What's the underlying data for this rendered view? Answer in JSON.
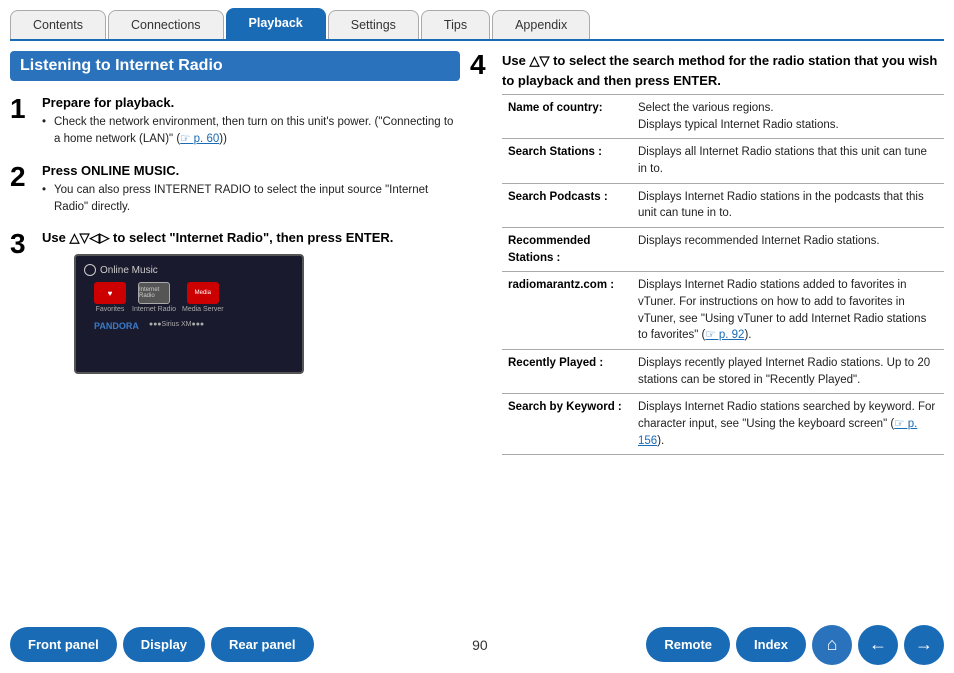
{
  "tabs": [
    {
      "label": "Contents",
      "active": false
    },
    {
      "label": "Connections",
      "active": false
    },
    {
      "label": "Playback",
      "active": true
    },
    {
      "label": "Settings",
      "active": false
    },
    {
      "label": "Tips",
      "active": false
    },
    {
      "label": "Appendix",
      "active": false
    }
  ],
  "section_title": "Listening to Internet Radio",
  "steps": [
    {
      "number": "1",
      "heading": "Prepare for playback.",
      "bullets": [
        "Check the network environment, then turn on this unit's power. (\"Connecting to a home network (LAN)\" (☞ p. 60))"
      ]
    },
    {
      "number": "2",
      "heading": "Press ONLINE MUSIC.",
      "bullets": [
        "You can also press INTERNET RADIO to select the input source \"Internet Radio\" directly."
      ]
    },
    {
      "number": "3",
      "heading": "Use △▽◁▷ to select \"Internet Radio\", then press ENTER.",
      "bullets": []
    }
  ],
  "step4": {
    "number": "4",
    "heading": "Use △▽ to select the search method for the radio station that you wish to playback and then press ENTER."
  },
  "table": [
    {
      "label": "Name of country:",
      "description": "Select the various regions.\nDisplays typical Internet Radio stations."
    },
    {
      "label": "Search Stations :",
      "description": "Displays all Internet Radio stations that this unit can tune in to."
    },
    {
      "label": "Search Podcasts :",
      "description": "Displays Internet Radio stations in the podcasts that this unit can tune in to."
    },
    {
      "label": "Recommended\nStations :",
      "description": "Displays recommended Internet Radio stations."
    },
    {
      "label": "radiomarantz.com :",
      "description": "Displays Internet Radio stations added to favorites in vTuner. For instructions on how to add to favorites in vTuner, see \"Using vTuner to add Internet Radio stations to favorites\" (☞ p. 92)."
    },
    {
      "label": "Recently Played :",
      "description": "Displays recently played Internet Radio stations. Up to 20 stations can be stored in \"Recently Played\"."
    },
    {
      "label": "Search by Keyword :",
      "description": "Displays Internet Radio stations searched by keyword. For character input, see \"Using the keyboard screen\" (☞ p. 156)."
    }
  ],
  "screen": {
    "header": "Online Music",
    "items": [
      {
        "label": "Favorites",
        "type": "favorites"
      },
      {
        "label": "Internet Radio",
        "type": "internet"
      },
      {
        "label": "Media Server",
        "type": "media"
      }
    ],
    "bottom": [
      "PANDORA",
      "●●●●●●●●"
    ]
  },
  "page_number": "90",
  "bottom_nav": {
    "front_panel": "Front panel",
    "display": "Display",
    "rear_panel": "Rear panel",
    "remote": "Remote",
    "index": "Index"
  }
}
